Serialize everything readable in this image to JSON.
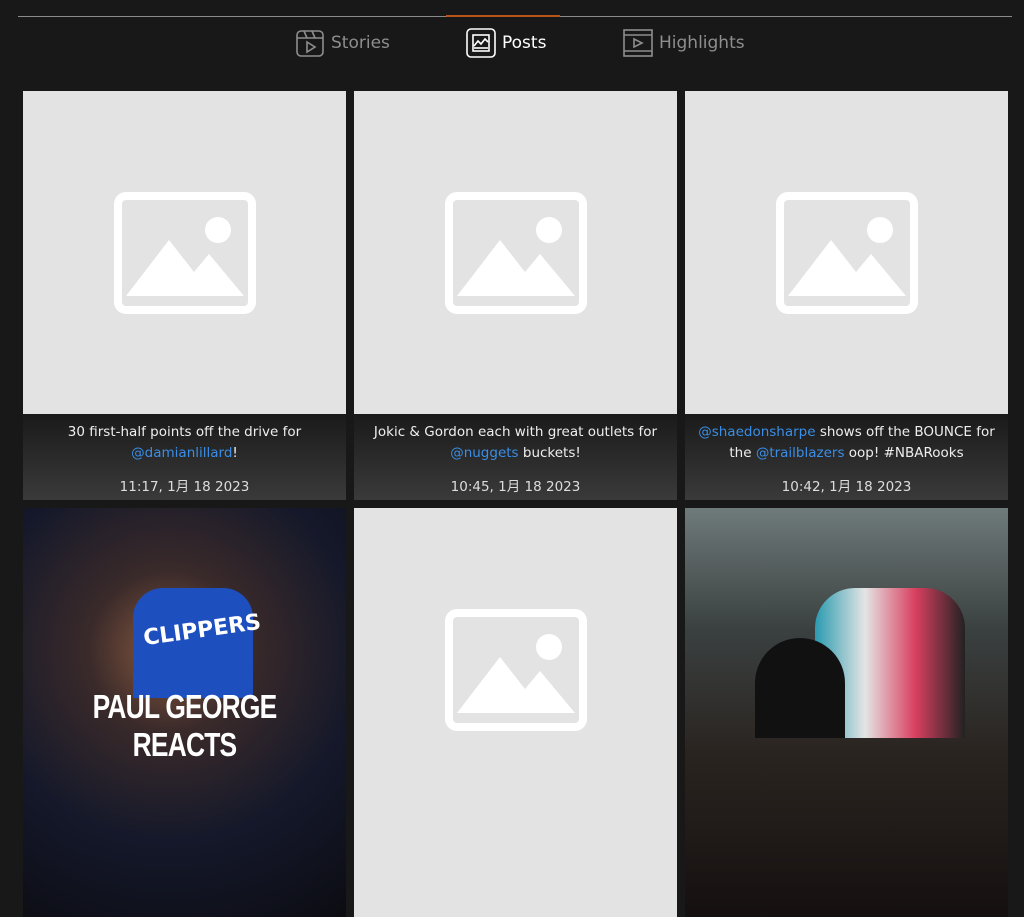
{
  "tabs": [
    {
      "label": "Stories",
      "icon": "stories-icon",
      "active": false
    },
    {
      "label": "Posts",
      "icon": "posts-icon",
      "active": true
    },
    {
      "label": "Highlights",
      "icon": "highlights-icon",
      "active": false
    }
  ],
  "accent_color": "#b8561a",
  "mention_color": "#3a8ee6",
  "posts": [
    {
      "text_before": "30 first-half points off the drive for ",
      "mention1": "@damianlillard",
      "text_mid": "!",
      "mention2": "",
      "text_after": "",
      "time": "11:17, 1月 18 2023"
    },
    {
      "text_before": "Jokic & Gordon each with great outlets for ",
      "mention1": "@nuggets",
      "text_mid": " buckets!",
      "mention2": "",
      "text_after": "",
      "time": "10:45, 1月 18 2023"
    },
    {
      "text_before": "",
      "mention1": "@shaedonsharpe",
      "text_mid": " shows off the BOUNCE for the ",
      "mention2": "@trailblazers",
      "text_after": " oop! #NBARooks",
      "time": "10:42, 1月 18 2023"
    },
    {
      "overlay": "PAUL GEORGE REACTS",
      "jersey": "CLIPPERS"
    }
  ]
}
